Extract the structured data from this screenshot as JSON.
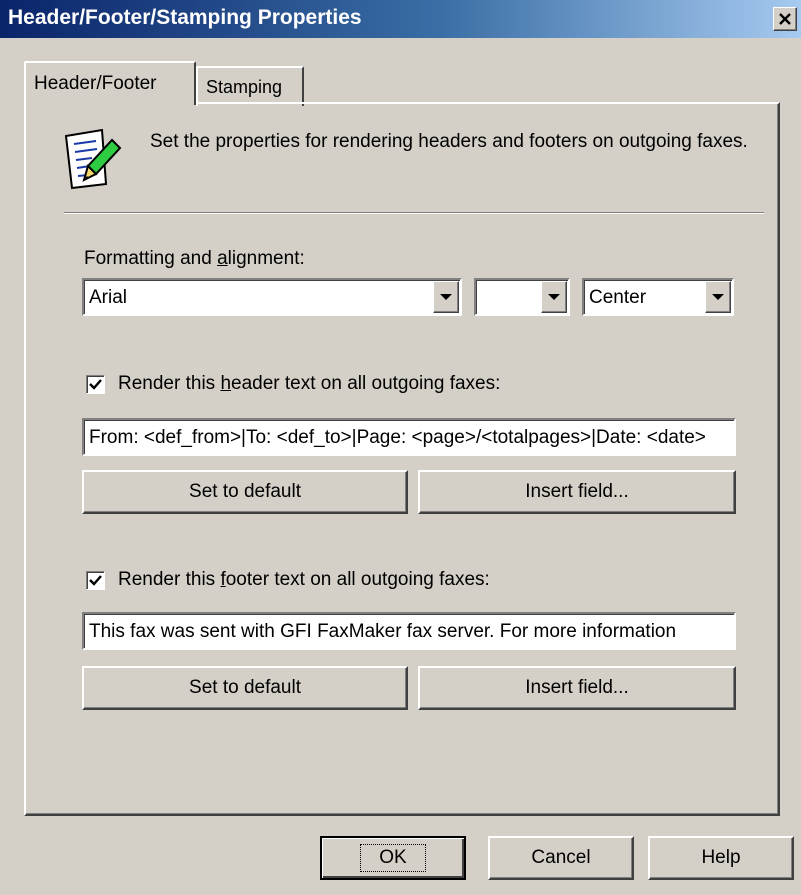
{
  "window": {
    "title": "Header/Footer/Stamping Properties",
    "close_glyph": "✕"
  },
  "tabs": [
    {
      "label": "Header/Footer",
      "selected": true
    },
    {
      "label": "Stamping",
      "selected": false
    }
  ],
  "description": "Set the properties for rendering headers and footers on outgoing faxes.",
  "formatting": {
    "label_before": "Formatting and ",
    "label_mnemonic": "a",
    "label_after": "lignment:",
    "font_value": "Arial",
    "size_value": "",
    "alignment_value": "Center"
  },
  "header": {
    "checkbox_label_before": "Render this ",
    "checkbox_label_mnemonic": "h",
    "checkbox_label_after": "eader text on all outgoing faxes:",
    "checked": true,
    "text_value": "From: <def_from>|To: <def_to>|Page: <page>/<totalpages>|Date: <date>",
    "set_default_label": "Set to default",
    "insert_field_label": "Insert field..."
  },
  "footer": {
    "checkbox_label_before": "Render this ",
    "checkbox_label_mnemonic": "f",
    "checkbox_label_after": "ooter text on all outgoing faxes:",
    "checked": true,
    "text_value": "This fax was sent with GFI FaxMaker fax server. For more information",
    "set_default_label": "Set to default",
    "insert_field_label": "Insert field..."
  },
  "buttons": {
    "ok": "OK",
    "cancel": "Cancel",
    "help": "Help"
  },
  "icons": {
    "close": "close-icon",
    "document": "document-pen-icon",
    "dropdown": "chevron-down-icon",
    "check": "checkmark-icon"
  }
}
